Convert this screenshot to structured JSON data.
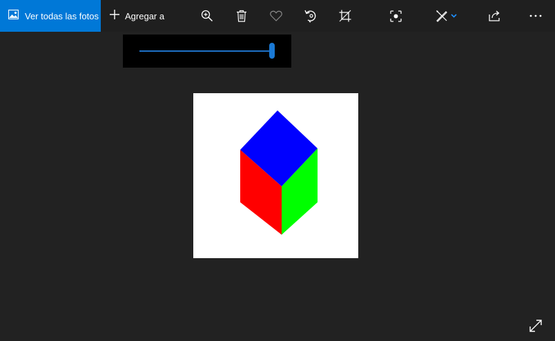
{
  "toolbar": {
    "all_photos_label": "Ver todas las fotos",
    "add_to_label": "Agregar a",
    "tools": [
      {
        "name": "zoom-icon"
      },
      {
        "name": "delete-icon"
      },
      {
        "name": "favorite-icon"
      },
      {
        "name": "rotate-icon"
      },
      {
        "name": "crop-icon"
      },
      {
        "name": "enhance-icon"
      },
      {
        "name": "edit-create-icon"
      },
      {
        "name": "share-icon"
      },
      {
        "name": "more-icon"
      }
    ]
  },
  "zoom": {
    "level": 1.0
  },
  "photo": {
    "subject": "cube",
    "colors": {
      "top": "#0000ff",
      "left": "#ff0000",
      "right": "#00ff00",
      "background": "#ffffff"
    }
  },
  "colors": {
    "accent": "#0078d7",
    "background": "#222222"
  },
  "footer": {
    "expand_icon": "fullscreen-icon"
  }
}
